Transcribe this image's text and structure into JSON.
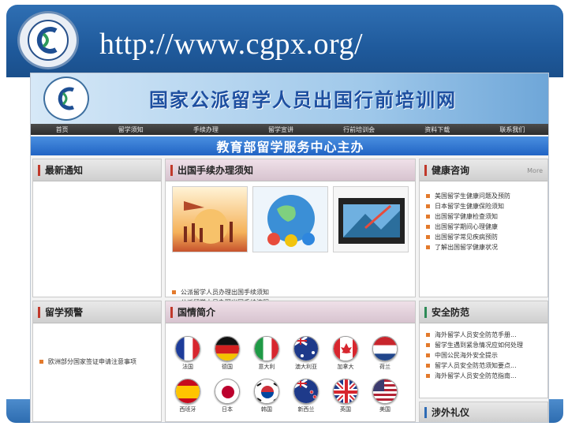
{
  "slide": {
    "url_title": "http://www.cgpx.org/"
  },
  "site": {
    "title": "国家公派留学人员出国行前培训网",
    "sponsor": "教育部留学服务中心主办",
    "nav": [
      "首页",
      "留学须知",
      "手续办理",
      "留学宣讲",
      "行前培训会",
      "资料下载",
      "联系我们"
    ],
    "panels": {
      "latest_notice": {
        "title": "最新通知"
      },
      "procedures": {
        "title": "出国手续办理须知",
        "items": [
          "公派留学人员办理出国手续须知",
          "公派留学人员办理出国手续流程"
        ]
      },
      "health": {
        "title": "健康咨询",
        "more": "More",
        "items": [
          "美国留学生健康问题及预防",
          "日本留学生健康保险须知",
          "出国留学健康检查须知",
          "出国留学期间心理健康",
          "出国留学常见疾病预防",
          "了解出国留学健康状况"
        ]
      },
      "warning": {
        "title": "留学预警",
        "items": [
          "欧洲部分国家签证申请注意事项"
        ]
      },
      "country": {
        "title": "国情简介",
        "flags": [
          {
            "label": "法国",
            "icon": "france-flag-icon"
          },
          {
            "label": "德国",
            "icon": "germany-flag-icon"
          },
          {
            "label": "意大利",
            "icon": "italy-flag-icon"
          },
          {
            "label": "澳大利亚",
            "icon": "australia-flag-icon"
          },
          {
            "label": "加拿大",
            "icon": "canada-flag-icon"
          },
          {
            "label": "荷兰",
            "icon": "netherlands-flag-icon"
          },
          {
            "label": "西班牙",
            "icon": "spain-flag-icon"
          },
          {
            "label": "日本",
            "icon": "japan-flag-icon"
          },
          {
            "label": "韩国",
            "icon": "korea-flag-icon"
          },
          {
            "label": "新西兰",
            "icon": "new-zealand-flag-icon"
          },
          {
            "label": "英国",
            "icon": "uk-flag-icon"
          },
          {
            "label": "美国",
            "icon": "usa-flag-icon"
          }
        ]
      },
      "safety": {
        "title": "安全防范",
        "items": [
          "海外留学人员安全防范手册...",
          "留学生遇到紧急情况应如何处理",
          "中国公民海外安全提示",
          "留学人员安全防范须知要点...",
          "海外留学人员安全防范指南..."
        ]
      },
      "etiquette": {
        "title": "涉外礼仪"
      }
    }
  },
  "colors": {
    "header_blue": "#1f5a9c",
    "site_title_blue": "#1e4fa0",
    "sponsor_blue": "#2164c4",
    "bullet_orange": "#e37a2c"
  }
}
